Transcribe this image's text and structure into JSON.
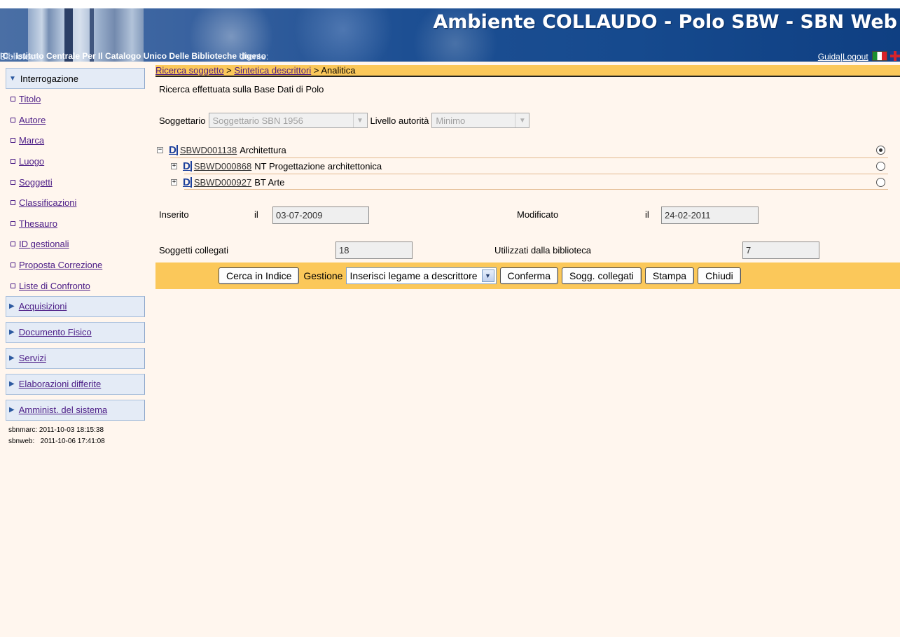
{
  "header": {
    "title": "Ambiente COLLAUDO - Polo SBW - SBN Web",
    "biblioteca_label": "Biblioteca:",
    "biblioteca_value": "IC - Istituto Centrale Per Il Catalogo Unico Delle Biblioteche",
    "utente_label": "Utente:",
    "utente_value": "digeso",
    "guida": "Guida",
    "separator": "|",
    "logout": "Logout"
  },
  "sidebar": {
    "section_interrogazione": "Interrogazione",
    "items": [
      {
        "label": "Titolo"
      },
      {
        "label": "Autore"
      },
      {
        "label": "Marca"
      },
      {
        "label": "Luogo"
      },
      {
        "label": "Soggetti"
      },
      {
        "label": "Classificazioni"
      },
      {
        "label": "Thesauro"
      },
      {
        "label": "ID gestionali"
      },
      {
        "label": "Proposta Correzione"
      },
      {
        "label": "Liste di Confronto"
      }
    ],
    "sections": [
      {
        "label": "Acquisizioni"
      },
      {
        "label": "Documento Fisico"
      },
      {
        "label": "Servizi"
      },
      {
        "label": "Elaborazioni differite"
      },
      {
        "label": "Amminist. del sistema"
      }
    ],
    "stamp_sbnmarc": "sbnmarc: 2011-10-03 18:15:38",
    "stamp_sbnweb": "sbnweb:   2011-10-06 17:41:08"
  },
  "breadcrumb": {
    "link1": "Ricerca soggetto",
    "sep1": " > ",
    "link2": "Sintetica descrittori",
    "sep2": " > ",
    "current": "Analitica"
  },
  "main": {
    "message": "Ricerca effettuata sulla Base Dati di Polo",
    "soggettario_label": "Soggettario",
    "soggettario_value": "Soggettario SBN 1956",
    "livello_label": "Livello autorità",
    "livello_value": "Minimo",
    "tree": [
      {
        "code": "SBWD001138",
        "text": "Architettura",
        "toggle": "−",
        "selected": true
      },
      {
        "code": "SBWD000868",
        "text": "NT Progettazione architettonica",
        "toggle": "+",
        "selected": false
      },
      {
        "code": "SBWD000927",
        "text": "BT Arte",
        "toggle": "+",
        "selected": false
      }
    ],
    "d_icon": "D",
    "inserito_label": "Inserito",
    "il_label": "il",
    "inserito_value": "03-07-2009",
    "modificato_label": "Modificato",
    "modificato_value": "24-02-2011",
    "soggetti_collegati_label": "Soggetti collegati",
    "soggetti_collegati_value": "18",
    "utilizzati_label": "Utilizzati dalla biblioteca",
    "utilizzati_value": "7"
  },
  "buttons": {
    "cerca_indice": "Cerca in Indice",
    "gestione_label": "Gestione",
    "gestione_value": "Inserisci legame a descrittore",
    "conferma": "Conferma",
    "sogg_collegati": "Sogg. collegati",
    "stampa": "Stampa",
    "chiudi": "Chiudi"
  }
}
